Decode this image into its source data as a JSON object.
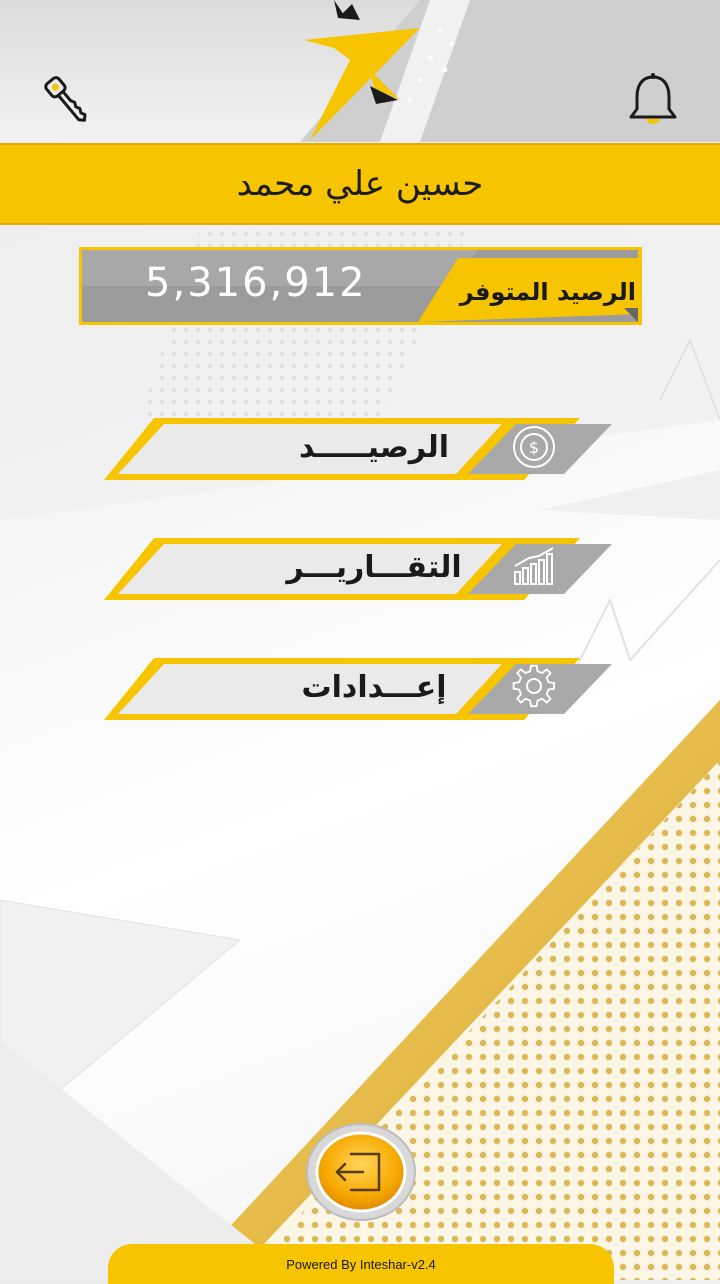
{
  "user": {
    "name": "حسين علي محمد"
  },
  "balance": {
    "label": "الرصيد المتوفر",
    "value": "5,316,912"
  },
  "menu": [
    {
      "label": "الرصيـــــد",
      "icon": "dollar-coin-icon"
    },
    {
      "label": "التقـــاريـــر",
      "icon": "bar-chart-icon"
    },
    {
      "label": "إعـــدادات",
      "icon": "gear-icon"
    }
  ],
  "footer": {
    "text": "Powered By Inteshar-v2.4"
  },
  "icons": {
    "key": "key-icon",
    "bell": "bell-icon",
    "logout": "logout-icon",
    "logo": "logo-icon"
  },
  "colors": {
    "accent": "#f7c400",
    "dark": "#1a1a1a",
    "gray": "#9a9a9a",
    "gold": "#c9a23a"
  }
}
